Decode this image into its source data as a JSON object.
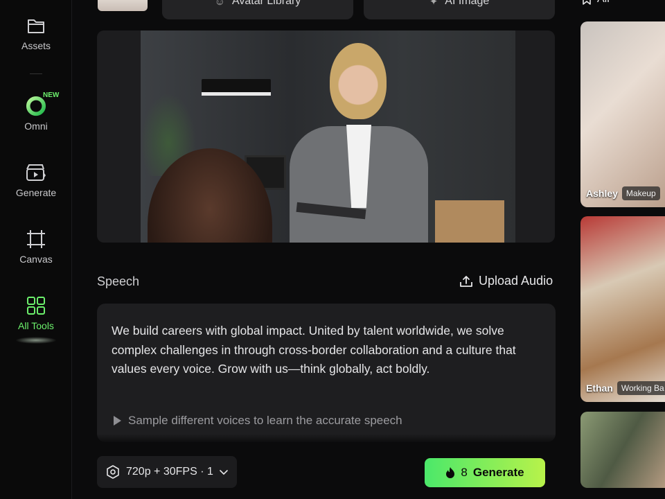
{
  "sidebar": {
    "items": [
      {
        "label": "Assets",
        "icon": "folder-icon"
      },
      {
        "label": "Omni",
        "icon": "omni-ring-icon",
        "badge": "NEW"
      },
      {
        "label": "Generate",
        "icon": "clapperboard-icon"
      },
      {
        "label": "Canvas",
        "icon": "canvas-frame-icon"
      },
      {
        "label": "All Tools",
        "icon": "grid-icon",
        "active": true
      }
    ]
  },
  "top_tabs": [
    {
      "label": "Avatar Library",
      "icon": "avatar-icon"
    },
    {
      "label": "AI Image",
      "icon": "sparkle-icon"
    }
  ],
  "speech": {
    "label": "Speech",
    "upload_label": "Upload Audio",
    "text": "We build careers with global impact. United by talent worldwide, we solve complex challenges in through cross-border collaboration and a culture that values every voice. Grow with us—think globally, act boldly.",
    "sample_hint": "Sample different voices to learn the accurate speech"
  },
  "bottom": {
    "settings_label": "720p + 30FPS · 1",
    "generate_credits": "8",
    "generate_label": "Generate"
  },
  "gallery": {
    "filter_label": "All",
    "cards": [
      {
        "name": "Ashley",
        "tag": "Makeup"
      },
      {
        "name": "Ethan",
        "tag": "Working Ba"
      },
      {
        "name": "",
        "tag": ""
      }
    ]
  },
  "colors": {
    "accent": "#6cf06c",
    "generate_start": "#4be86a",
    "generate_end": "#b8f24a"
  }
}
